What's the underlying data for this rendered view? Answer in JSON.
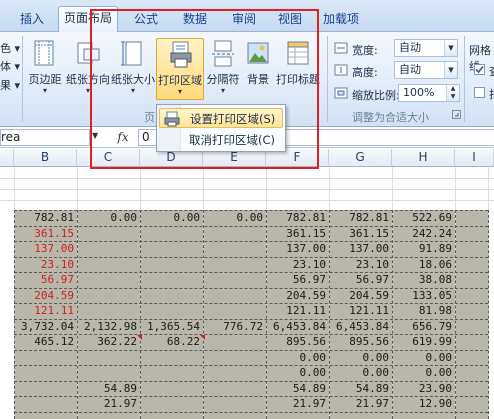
{
  "tabs": [
    "插入",
    "页面布局",
    "公式",
    "数据",
    "审阅",
    "视图",
    "加载项"
  ],
  "ribbon": {
    "left_partial": {
      "row1": "色 ▾",
      "row2": "体 ▾",
      "row3": "果 ▾",
      "btn_label": "页边距"
    },
    "buttons": {
      "page_margin": "页边距",
      "orientation": "纸张方向",
      "size": "纸张大小",
      "print_area": "打印区域",
      "breaks": "分隔符",
      "background": "背景",
      "print_titles": "打印标题"
    },
    "group_partial_label": "页",
    "scale_group": {
      "width_label": "宽度:",
      "width_value": "自动",
      "height_label": "高度:",
      "height_value": "自动",
      "zoom_label": "缩放比例:",
      "zoom_value": "100%",
      "group_label": "调整为合适大小"
    },
    "sheet_options": {
      "title": "网格线",
      "view_partial": "查",
      "print_partial": "打"
    }
  },
  "menu": {
    "items": [
      "设置打印区域(S)",
      "取消打印区域(C)"
    ]
  },
  "formula_bar": {
    "name_box": "rea",
    "fx": "fx",
    "value": "0"
  },
  "columns": [
    "B",
    "C",
    "D",
    "E",
    "F",
    "G",
    "H",
    "I"
  ],
  "grid": {
    "rows": [
      {
        "B": "782.81",
        "C": "0.00",
        "D": "0.00",
        "E": "0.00",
        "F": "782.81",
        "G": "782.81",
        "H": "522.69"
      },
      {
        "B": "361.15",
        "F": "361.15",
        "G": "361.15",
        "H": "242.24"
      },
      {
        "B": "137.00",
        "F": "137.00",
        "G": "137.00",
        "H": "91.89"
      },
      {
        "B": "23.10",
        "F": "23.10",
        "G": "23.10",
        "H": "18.06"
      },
      {
        "B": "56.97",
        "F": "56.97",
        "G": "56.97",
        "H": "38.08"
      },
      {
        "B": "204.59",
        "F": "204.59",
        "G": "204.59",
        "H": "133.05"
      },
      {
        "B": "121.11",
        "F": "121.11",
        "G": "121.11",
        "H": "81.98"
      },
      {
        "B": "3,732.04",
        "C": "2,132.98",
        "D": "1,365.54",
        "E": "776.72",
        "F": "6,453.84",
        "G": "6,453.84",
        "H": "656.79"
      },
      {
        "B": "465.12",
        "C": "362.22",
        "D": "68.22",
        "F": "895.56",
        "G": "895.56",
        "H": "619.99"
      },
      {
        "F": "0.00",
        "G": "0.00",
        "H": "0.00"
      },
      {
        "F": "0.00",
        "G": "0.00",
        "H": "0.00"
      },
      {
        "C": "54.89",
        "F": "54.89",
        "G": "54.89",
        "H": "23.90"
      },
      {
        "C": "21.97",
        "F": "21.97",
        "G": "21.97",
        "H": "12.90"
      }
    ],
    "red_cells_in_B": [
      1,
      2,
      3,
      4,
      5,
      6
    ]
  },
  "colors": {
    "highlight_box": "#e02020",
    "red_text": "#cc2222",
    "print_fill": "#b9b7a9"
  }
}
